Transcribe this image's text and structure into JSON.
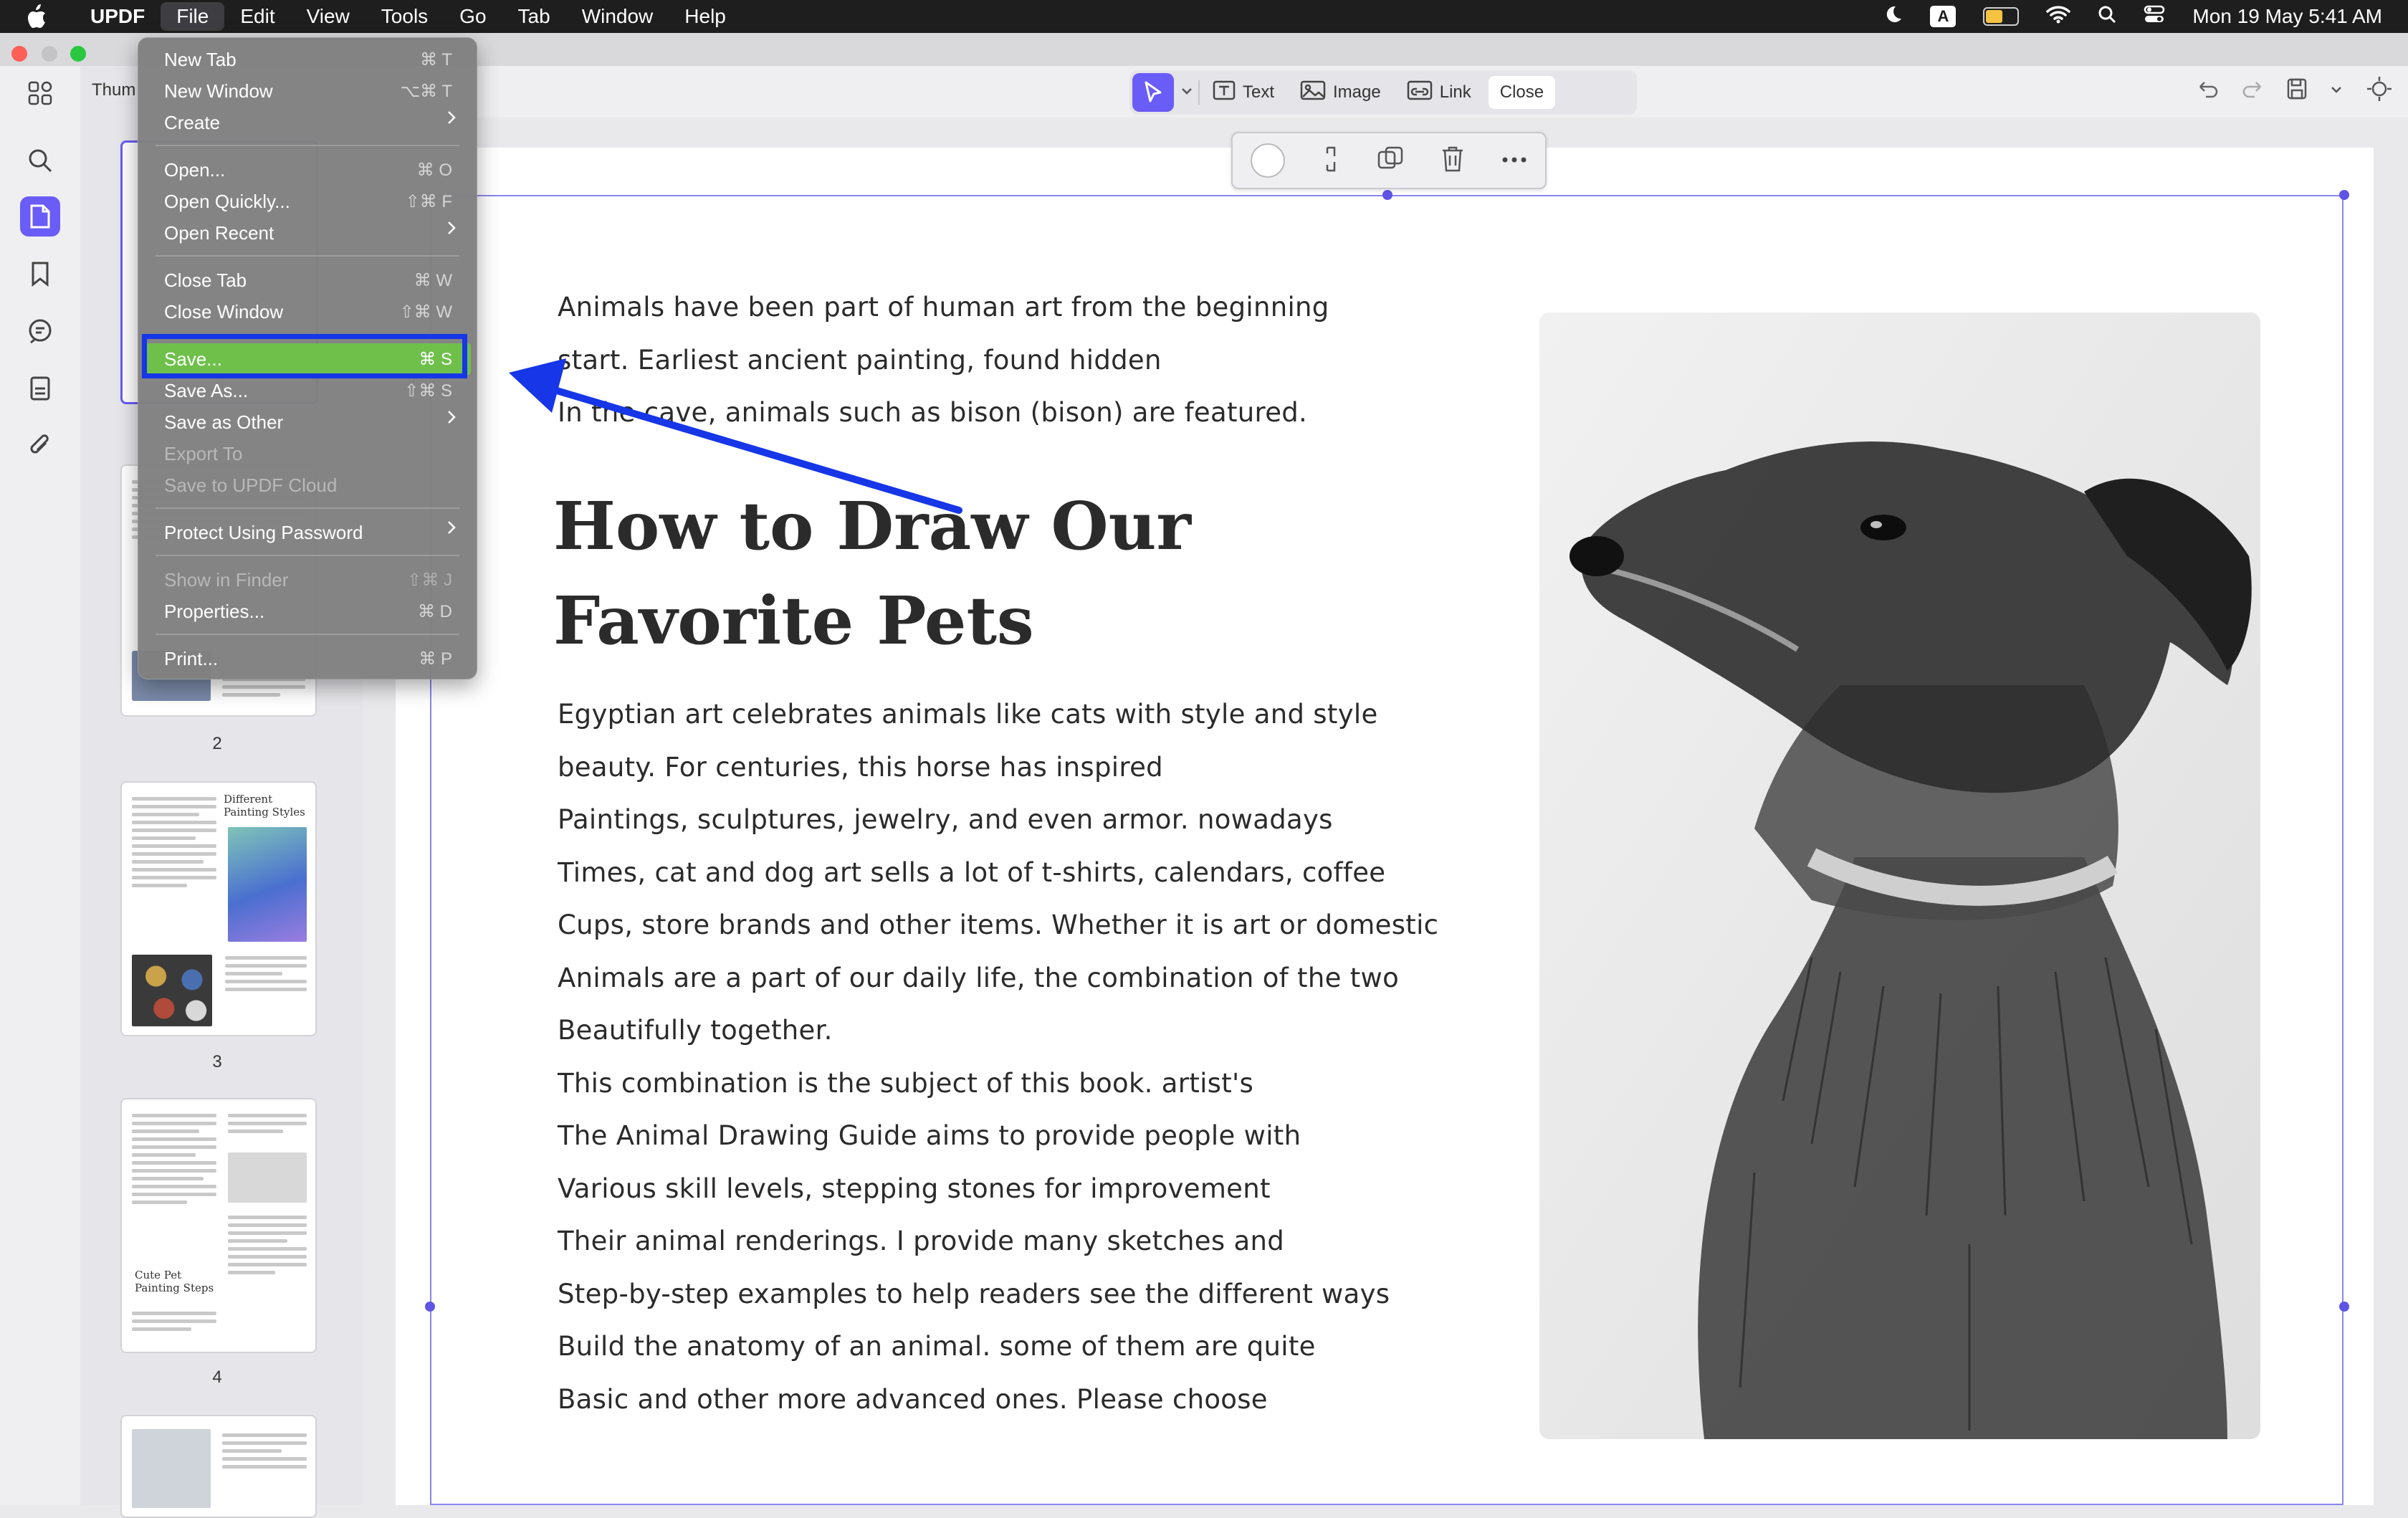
{
  "menubar": {
    "app": "UPDF",
    "items": [
      "File",
      "Edit",
      "View",
      "Tools",
      "Go",
      "Tab",
      "Window",
      "Help"
    ],
    "input_indicator": "A",
    "datetime": "Mon 19 May  5:41 AM"
  },
  "sidebar": {
    "header": "Thum"
  },
  "thumbnails": [
    {
      "page": "2"
    },
    {
      "page": "3",
      "title": "Different Painting Styles"
    },
    {
      "page": "4",
      "title": "Cute Pet Painting Steps"
    }
  ],
  "toolbar": {
    "text_label": "Text",
    "image_label": "Image",
    "link_label": "Link",
    "close_label": "Close"
  },
  "file_menu": {
    "new_tab": {
      "label": "New Tab",
      "shortcut": "⌘ T"
    },
    "new_window": {
      "label": "New Window",
      "shortcut": "⌥⌘ T"
    },
    "create": {
      "label": "Create"
    },
    "open": {
      "label": "Open...",
      "shortcut": "⌘ O"
    },
    "open_quickly": {
      "label": "Open Quickly...",
      "shortcut": "⇧⌘ F"
    },
    "open_recent": {
      "label": "Open Recent"
    },
    "close_tab": {
      "label": "Close Tab",
      "shortcut": "⌘ W"
    },
    "close_window": {
      "label": "Close Window",
      "shortcut": "⇧⌘ W"
    },
    "save": {
      "label": "Save...",
      "shortcut": "⌘ S"
    },
    "save_as": {
      "label": "Save As...",
      "shortcut": "⇧⌘ S"
    },
    "save_as_other": {
      "label": "Save as Other"
    },
    "export_to": {
      "label": "Export To"
    },
    "save_to_cloud": {
      "label": "Save to UPDF Cloud"
    },
    "protect": {
      "label": "Protect Using Password"
    },
    "show_in_finder": {
      "label": "Show in Finder",
      "shortcut": "⇧⌘ J"
    },
    "properties": {
      "label": "Properties...",
      "shortcut": "⌘ D"
    },
    "print": {
      "label": "Print...",
      "shortcut": "⌘ P"
    }
  },
  "document": {
    "intro_lines": [
      "Animals have been part of human art from the beginning",
      "start. Earliest ancient painting, found hidden",
      "In the cave, animals such as bison (bison) are featured."
    ],
    "heading_lines": [
      "How to Draw Our",
      "Favorite Pets"
    ],
    "body_lines": [
      "Egyptian art celebrates animals like cats with style and style",
      "beauty. For centuries, this horse has inspired",
      "Paintings, sculptures, jewelry, and even armor. nowadays",
      "Times, cat and dog art sells a lot of t-shirts, calendars, coffee",
      "Cups, store brands and other items. Whether it is art or domestic",
      "Animals are a part of our daily life, the combination of the two",
      "Beautifully together.",
      "This combination is the subject of this book. artist's",
      "The Animal Drawing Guide aims to provide people with",
      "Various skill levels, stepping stones for improvement",
      "Their animal renderings. I provide many sketches and",
      "Step-by-step examples to help readers see the different ways",
      "Build the anatomy of an animal. some of them are quite",
      "Basic and other more advanced ones. Please choose"
    ]
  },
  "colors": {
    "accent": "#6a5cf6",
    "menu_highlight": "#6ec04b",
    "annotation_blue": "#1636e8"
  }
}
